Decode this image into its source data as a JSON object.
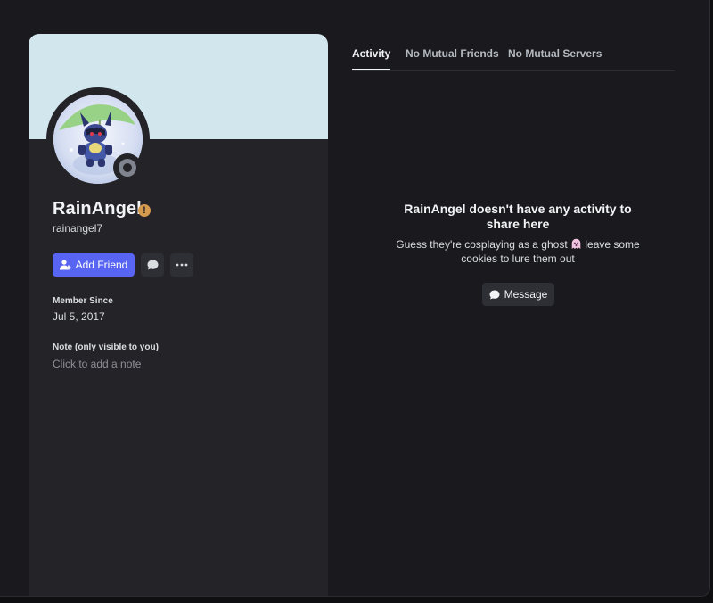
{
  "profile": {
    "display_name": "RainAngel",
    "username": "rainangel7",
    "badge_glyph": "!",
    "banner_color": "#d2e6ee",
    "status": "offline",
    "status_color": "#80848e",
    "add_friend_label": "Add Friend",
    "member_since_label": "Member Since",
    "member_since_value": "Jul 5, 2017",
    "note_label": "Note (only visible to you)",
    "note_placeholder": "Click to add a note"
  },
  "tabs": [
    {
      "label": "Activity",
      "active": true
    },
    {
      "label": "No Mutual Friends",
      "active": false
    },
    {
      "label": "No Mutual Servers",
      "active": false
    }
  ],
  "activity": {
    "empty_title": "RainAngel doesn't have any activity to share here",
    "empty_sub_1": "Guess they're cosplaying as a ghost",
    "empty_sub_2": "leave some cookies to lure them out",
    "message_label": "Message"
  },
  "colors": {
    "accent": "#5865f2",
    "badge": "#d49a4e"
  }
}
